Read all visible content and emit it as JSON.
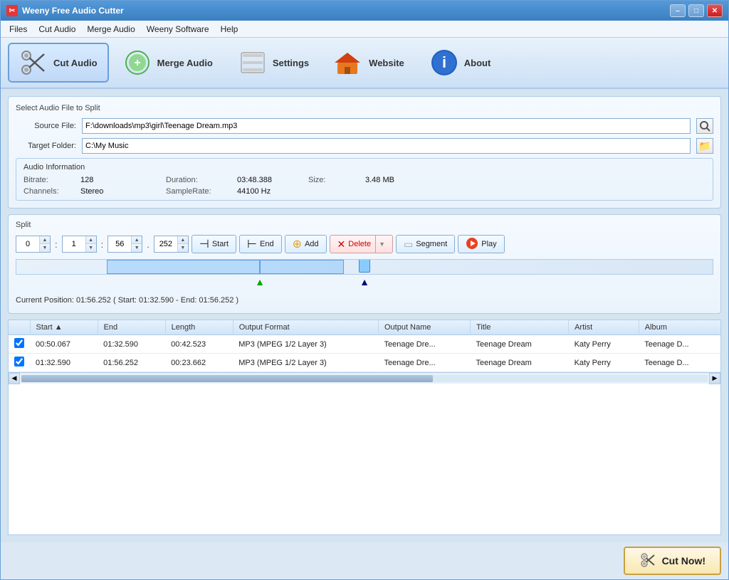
{
  "window": {
    "title": "Weeny Free Audio Cutter",
    "icon": "✂"
  },
  "titlebar": {
    "minimize": "–",
    "maximize": "□",
    "close": "✕"
  },
  "menubar": {
    "items": [
      "Files",
      "Cut Audio",
      "Merge Audio",
      "Weeny Software",
      "Help"
    ]
  },
  "toolbar": {
    "buttons": [
      {
        "id": "cut-audio",
        "label": "Cut Audio",
        "icon": "✂",
        "active": true
      },
      {
        "id": "merge-audio",
        "label": "Merge Audio",
        "icon": "💿"
      },
      {
        "id": "settings",
        "label": "Settings",
        "icon": "📋"
      },
      {
        "id": "website",
        "label": "Website",
        "icon": "🏠"
      },
      {
        "id": "about",
        "label": "About",
        "icon": "ℹ"
      }
    ]
  },
  "source_file": {
    "label": "Source File:",
    "value": "F:\\downloads\\mp3\\girl\\Teenage Dream.mp3"
  },
  "target_folder": {
    "label": "Target Folder:",
    "value": "C:\\My Music"
  },
  "audio_info": {
    "section_label": "Audio Information",
    "bitrate_label": "Bitrate:",
    "bitrate_value": "128",
    "channels_label": "Channels:",
    "channels_value": "Stereo",
    "duration_label": "Duration:",
    "duration_value": "03:48.388",
    "samplerate_label": "SampleRate:",
    "samplerate_value": "44100 Hz",
    "size_label": "Size:",
    "size_value": "3.48 MB"
  },
  "split": {
    "section_label": "Split",
    "minutes_value": "0",
    "seconds_value": "1",
    "tenths_value": "56",
    "millis_value": "252",
    "start_btn": "Start",
    "end_btn": "End",
    "add_btn": "Add",
    "delete_btn": "Delete",
    "segment_btn": "Segment",
    "play_btn": "Play",
    "position_label": "Current Position: 01:56.252 ( Start: 01:32.590 - End: 01:56.252 )"
  },
  "table": {
    "columns": [
      "",
      "Start",
      "▲",
      "End",
      "Length",
      "Output Format",
      "Output Name",
      "Title",
      "Artist",
      "Album"
    ],
    "rows": [
      {
        "checked": true,
        "start": "00:50.067",
        "end": "01:32.590",
        "length": "00:42.523",
        "format": "MP3 (MPEG 1/2 Layer 3)",
        "output_name": "Teenage Dre...",
        "title": "Teenage Dream",
        "artist": "Katy Perry",
        "album": "Teenage D..."
      },
      {
        "checked": true,
        "start": "01:32.590",
        "end": "01:56.252",
        "length": "00:23.662",
        "format": "MP3 (MPEG 1/2 Layer 3)",
        "output_name": "Teenage Dre...",
        "title": "Teenage Dream",
        "artist": "Katy Perry",
        "album": "Teenage D..."
      }
    ]
  },
  "cut_now_btn": "Cut Now!",
  "select_section_label": "Select Audio File to Split"
}
